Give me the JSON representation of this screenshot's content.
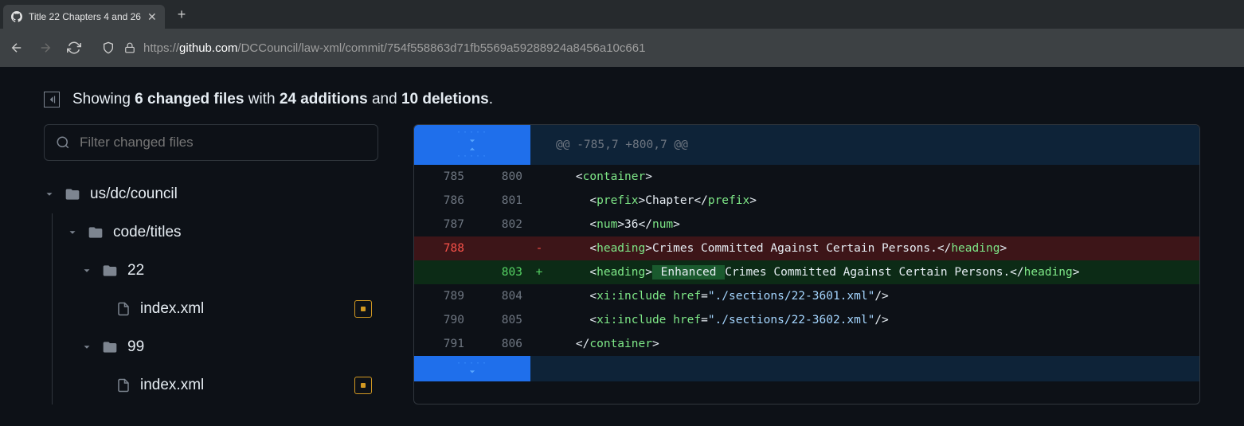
{
  "browser": {
    "tab_title": "Title 22 Chapters 4 and 26",
    "url_protocol": "https://",
    "url_domain": "github.com",
    "url_path": "/DCCouncil/law-xml/commit/754f558863d71fb5569a59288924a8456a10c661"
  },
  "summary": {
    "prefix": "Showing ",
    "files": "6 changed files",
    "with": " with ",
    "additions": "24 additions",
    "and": " and ",
    "deletions": "10 deletions",
    "suffix": "."
  },
  "filter": {
    "placeholder": "Filter changed files"
  },
  "tree": {
    "items": [
      {
        "label": "us/dc/council",
        "type": "folder"
      },
      {
        "label": "code/titles",
        "type": "folder"
      },
      {
        "label": "22",
        "type": "folder"
      },
      {
        "label": "index.xml",
        "type": "file"
      },
      {
        "label": "99",
        "type": "folder"
      },
      {
        "label": "index.xml",
        "type": "file"
      }
    ]
  },
  "diff": {
    "hunk_header": "@@ -785,7 +800,7 @@",
    "rows": [
      {
        "old": "785",
        "new": "800",
        "marker": " ",
        "indent": "    ",
        "xml": {
          "tag": "container",
          "self": false,
          "close": false
        }
      },
      {
        "old": "786",
        "new": "801",
        "marker": " ",
        "indent": "      ",
        "xml": {
          "tag": "prefix",
          "text": "Chapter"
        }
      },
      {
        "old": "787",
        "new": "802",
        "marker": " ",
        "indent": "      ",
        "xml": {
          "tag": "num",
          "text": "36"
        }
      },
      {
        "old": "788",
        "new": "",
        "marker": "-",
        "indent": "      ",
        "xml": {
          "tag": "heading",
          "text": "Crimes Committed Against Certain Persons."
        }
      },
      {
        "old": "",
        "new": "803",
        "marker": "+",
        "indent": "      ",
        "xml": {
          "tag": "heading",
          "added": " Enhanced ",
          "text": "Crimes Committed Against Certain Persons."
        }
      },
      {
        "old": "789",
        "new": "804",
        "marker": " ",
        "indent": "      ",
        "xml": {
          "ns": "xi:include",
          "href": "./sections/22-3601.xml"
        }
      },
      {
        "old": "790",
        "new": "805",
        "marker": " ",
        "indent": "      ",
        "xml": {
          "ns": "xi:include",
          "href": "./sections/22-3602.xml"
        }
      },
      {
        "old": "791",
        "new": "806",
        "marker": " ",
        "indent": "    ",
        "xml": {
          "tag": "container",
          "close_only": true
        }
      }
    ]
  }
}
